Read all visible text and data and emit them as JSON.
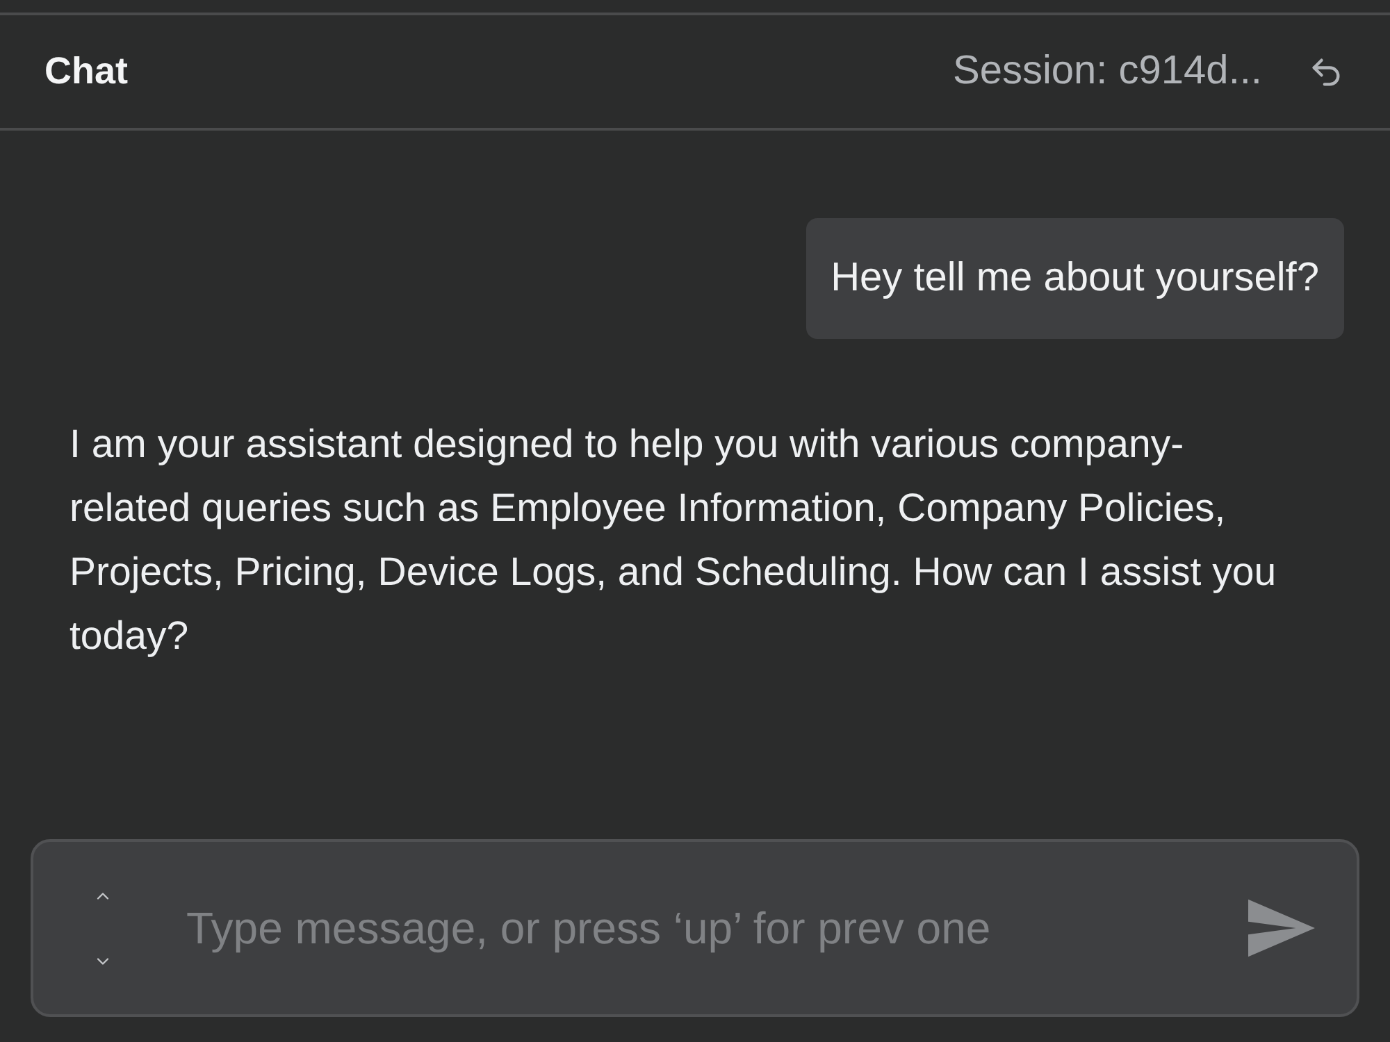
{
  "header": {
    "title": "Chat",
    "session": "Session: c914d..."
  },
  "messages": [
    {
      "kind": "user",
      "text": "Hey tell me about yourself?"
    },
    {
      "kind": "assistant",
      "text": "I am your assistant designed to help you with various company-related queries such as Employee Information, Company Policies, Projects, Pricing, Device Logs, and Scheduling. How can I assist you today?"
    }
  ],
  "composer": {
    "placeholder": "Type message, or press ‘up’ for prev one"
  }
}
